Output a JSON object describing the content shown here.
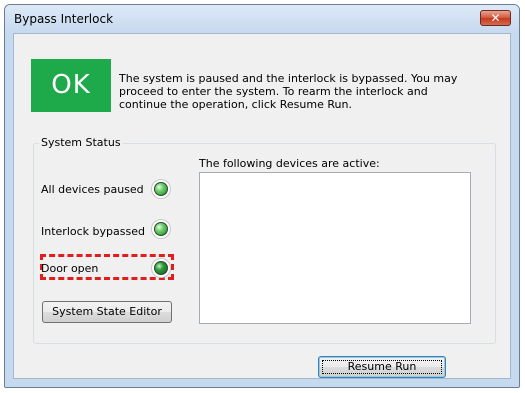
{
  "window": {
    "title": "Bypass Interlock",
    "close_symbol": "✕"
  },
  "banner": {
    "ok_text": "OK",
    "ok_color": "#1ea94b",
    "message": "The system is paused and the interlock is bypassed. You may proceed to enter the system. To rearm the interlock and continue the operation, click Resume Run."
  },
  "system_status": {
    "title": "System Status",
    "rows": [
      {
        "label": "All devices paused",
        "indicator": "green-led-icon"
      },
      {
        "label": "Interlock bypassed",
        "indicator": "green-led-icon"
      },
      {
        "label": "Door open",
        "indicator": "green-led-icon",
        "highlight_color": "#e21d1d"
      }
    ],
    "state_editor_label": "System State Editor",
    "devices_label": "The following devices are active:",
    "devices": []
  },
  "actions": {
    "resume_label": "Resume Run"
  }
}
